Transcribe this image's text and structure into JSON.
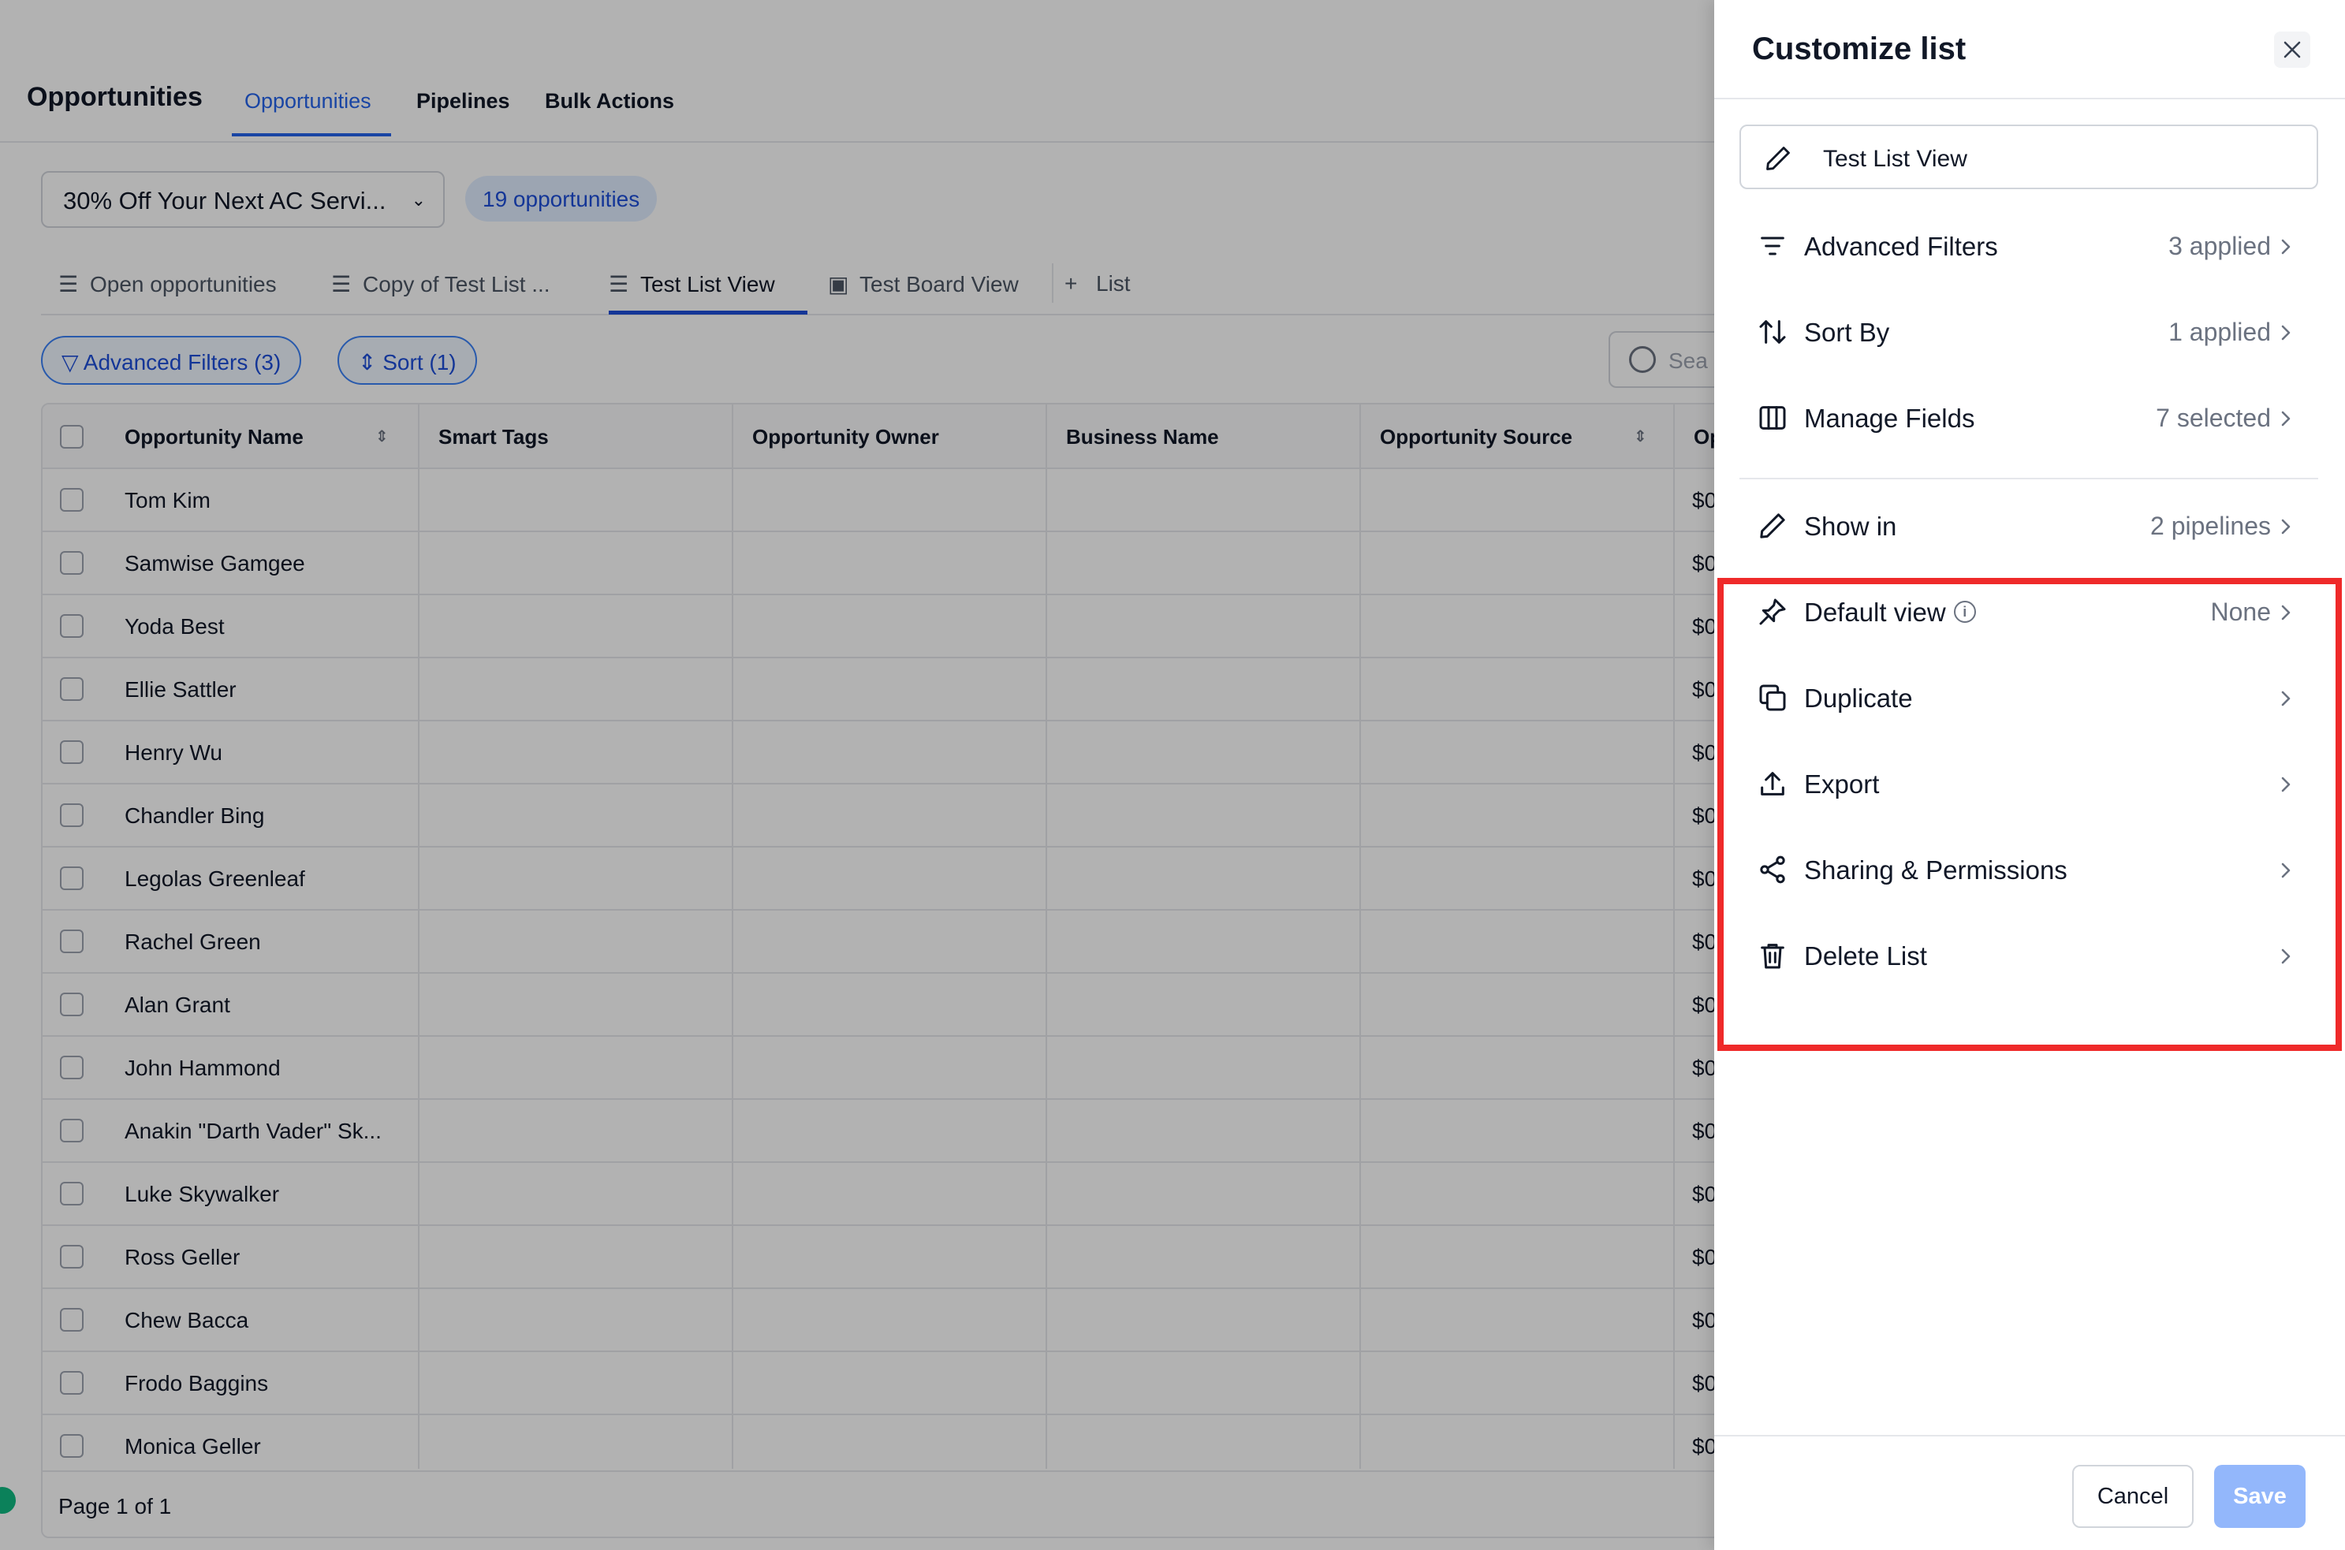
{
  "app": {
    "title": "Opportunities",
    "top_tabs": [
      {
        "label": "Opportunities"
      },
      {
        "label": "Pipelines"
      },
      {
        "label": "Bulk Actions"
      }
    ],
    "pipeline_select": "30% Off Your Next AC Servi...",
    "opportunity_count": "19 opportunities",
    "view_tabs": [
      {
        "label": "Open opportunities"
      },
      {
        "label": "Copy of Test List ..."
      },
      {
        "label": "Test List View"
      },
      {
        "label": "Test Board View"
      },
      {
        "label": "List"
      }
    ],
    "chips": {
      "advanced_filters": "Advanced Filters (3)",
      "sort": "Sort (1)"
    },
    "search_placeholder": "Sea",
    "table": {
      "columns": [
        "Opportunity Name",
        "Smart Tags",
        "Opportunity Owner",
        "Business Name",
        "Opportunity Source",
        "Op"
      ],
      "rows": [
        {
          "name": "Tom Kim",
          "amount": "$0"
        },
        {
          "name": "Samwise Gamgee",
          "amount": "$0"
        },
        {
          "name": "Yoda Best",
          "amount": "$0"
        },
        {
          "name": "Ellie Sattler",
          "amount": "$0"
        },
        {
          "name": "Henry Wu",
          "amount": "$0"
        },
        {
          "name": "Chandler Bing",
          "amount": "$0"
        },
        {
          "name": "Legolas Greenleaf",
          "amount": "$0"
        },
        {
          "name": "Rachel Green",
          "amount": "$0"
        },
        {
          "name": "Alan Grant",
          "amount": "$0"
        },
        {
          "name": "John Hammond",
          "amount": "$0"
        },
        {
          "name": "Anakin \"Darth Vader\" Sk...",
          "amount": "$0"
        },
        {
          "name": "Luke Skywalker",
          "amount": "$0"
        },
        {
          "name": "Ross Geller",
          "amount": "$0"
        },
        {
          "name": "Chew Bacca",
          "amount": "$0"
        },
        {
          "name": "Frodo Baggins",
          "amount": "$0"
        },
        {
          "name": "Monica Geller",
          "amount": "$0"
        }
      ],
      "pagination": "Page 1 of 1"
    }
  },
  "drawer": {
    "title": "Customize list",
    "list_name": "Test List View",
    "items": [
      {
        "icon": "filter-icon",
        "label": "Advanced Filters",
        "value": "3 applied"
      },
      {
        "icon": "sort-arrows-icon",
        "label": "Sort By",
        "value": "1 applied"
      },
      {
        "icon": "columns-icon",
        "label": "Manage Fields",
        "value": "7 selected"
      },
      {
        "icon": "pencil-icon",
        "label": "Show in",
        "value": "2 pipelines"
      },
      {
        "icon": "pin-icon",
        "label": "Default view",
        "value": "None"
      },
      {
        "icon": "copy-icon",
        "label": "Duplicate",
        "value": ""
      },
      {
        "icon": "upload-icon",
        "label": "Export",
        "value": ""
      },
      {
        "icon": "share-icon",
        "label": "Sharing & Permissions",
        "value": ""
      },
      {
        "icon": "trash-icon",
        "label": "Delete List",
        "value": ""
      }
    ],
    "cancel_label": "Cancel",
    "save_label": "Save"
  },
  "colors": {
    "accent": "#2563eb",
    "highlight": "#ef2a2a",
    "save_disabled": "#93b7fb"
  }
}
